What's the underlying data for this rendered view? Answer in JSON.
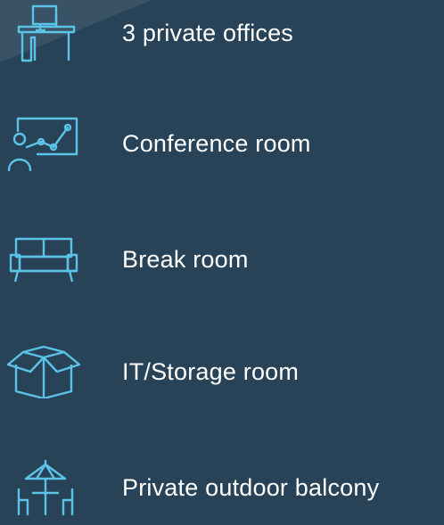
{
  "colors": {
    "background": "#284357",
    "corner_shade": "#3a5266",
    "icon_stroke": "#5cc3e8",
    "text": "#ffffff"
  },
  "amenities": [
    {
      "icon": "desk-icon",
      "label": "3 private offices"
    },
    {
      "icon": "presentation-icon",
      "label": "Conference room"
    },
    {
      "icon": "sofa-icon",
      "label": "Break room"
    },
    {
      "icon": "box-icon",
      "label": "IT/Storage room"
    },
    {
      "icon": "patio-umbrella-icon",
      "label": "Private outdoor balcony"
    }
  ]
}
